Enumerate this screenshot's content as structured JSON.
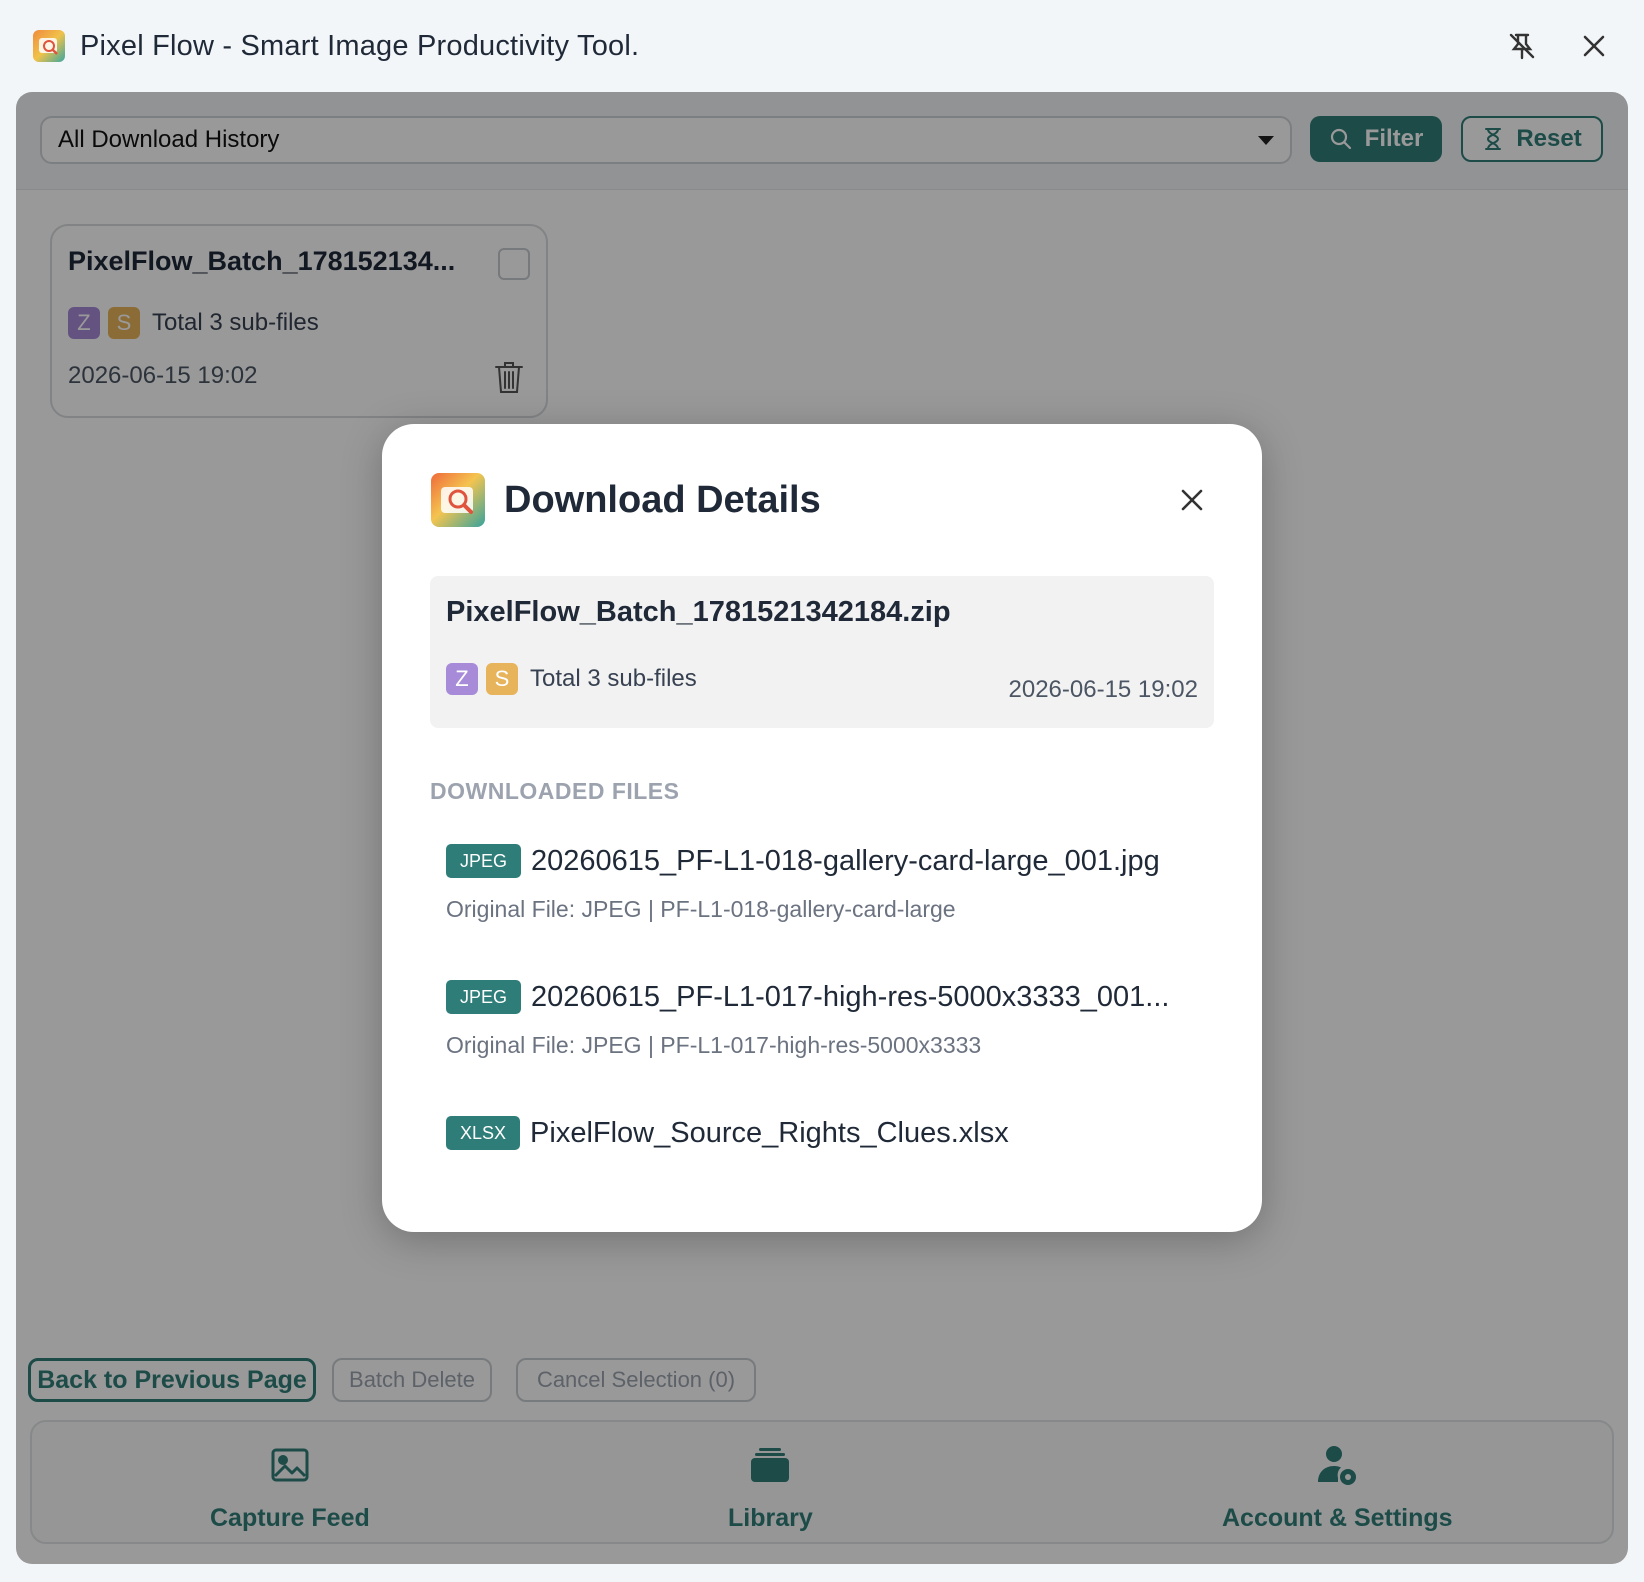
{
  "window": {
    "title": "Pixel Flow - Smart Image Productivity Tool."
  },
  "toolbar": {
    "select_value": "All Download History",
    "filter_label": "Filter",
    "reset_label": "Reset"
  },
  "card": {
    "name": "PixelFlow_Batch_178152134...",
    "badge_z": "Z",
    "badge_s": "S",
    "sub_files": "Total 3 sub-files",
    "date": "2026-06-15 19:02"
  },
  "actions": {
    "back": "Back to Previous Page",
    "batch_delete": "Batch Delete",
    "cancel_selection": "Cancel Selection (0)"
  },
  "nav": {
    "items": [
      {
        "label": "Capture Feed",
        "icon": "image-icon"
      },
      {
        "label": "Library",
        "icon": "layers-icon"
      },
      {
        "label": "Account & Settings",
        "icon": "user-gear-icon"
      }
    ]
  },
  "modal": {
    "title": "Download Details",
    "zip_name": "PixelFlow_Batch_1781521342184.zip",
    "badge_z": "Z",
    "badge_s": "S",
    "sub_files": "Total 3 sub-files",
    "date": "2026-06-15 19:02",
    "section_label": "DOWNLOADED FILES",
    "files": [
      {
        "type": "JPEG",
        "name": "20260615_PF-L1-018-gallery-card-large_001.jpg",
        "sub": "Original File: JPEG | PF-L1-018-gallery-card-large"
      },
      {
        "type": "JPEG",
        "name": "20260615_PF-L1-017-high-res-5000x3333_001...",
        "sub": "Original File: JPEG | PF-L1-017-high-res-5000x3333"
      },
      {
        "type": "XLSX",
        "name": "PixelFlow_Source_Rights_Clues.xlsx",
        "sub": ""
      }
    ]
  },
  "colors": {
    "accent": "#2f7d78",
    "badge_z": "#a78bd8",
    "badge_s": "#e8b45b"
  }
}
